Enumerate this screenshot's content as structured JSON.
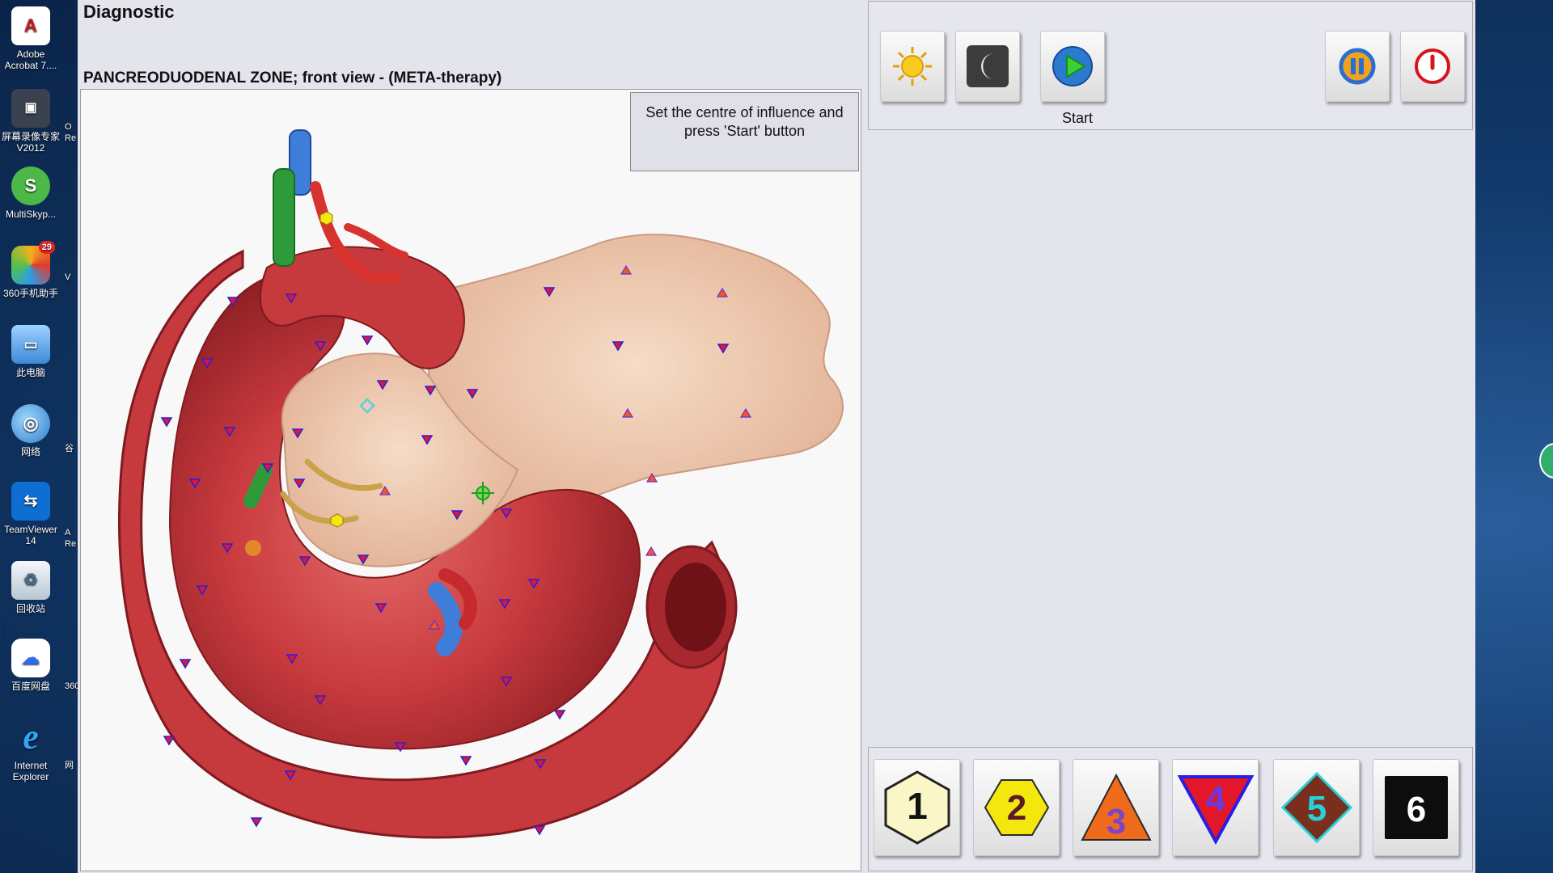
{
  "desktop": {
    "icons": [
      {
        "name": "adobe-acrobat",
        "label": "Adobe Acrobat 7...."
      },
      {
        "name": "screen-recorder",
        "label": "屏幕录像专家 V2012"
      },
      {
        "name": "multiskype",
        "label": "MultiSkyp..."
      },
      {
        "name": "360-phone-assistant",
        "label": "360手机助手",
        "badge": "29"
      },
      {
        "name": "this-pc",
        "label": "此电脑"
      },
      {
        "name": "network",
        "label": "网络"
      },
      {
        "name": "teamviewer",
        "label": "TeamViewer 14"
      },
      {
        "name": "recycle-bin",
        "label": "回收站"
      },
      {
        "name": "baidu-netdisk",
        "label": "百度网盘"
      },
      {
        "name": "internet-explorer",
        "label": "Internet Explorer"
      }
    ],
    "peek_labels": [
      "O Re",
      "V",
      "谷",
      "A Re",
      "360",
      "网"
    ]
  },
  "app": {
    "title": "Diagnostic",
    "zone_title": "PANCREODUODENAL ZONE; front view - (META-therapy)",
    "hint": "Set the centre of influence and press 'Start' button",
    "toolbar": {
      "day_icon": "sun-icon",
      "night_icon": "moon-icon",
      "start_icon": "play-icon",
      "start_label": "Start",
      "pause_icon": "pause-icon",
      "power_icon": "power-icon"
    },
    "levels": [
      {
        "label": "1",
        "shape": "hexagon",
        "fill": "#fbf6c7",
        "text_color": "#111111"
      },
      {
        "label": "2",
        "shape": "hexagon",
        "fill": "#f4e70d",
        "text_color": "#5a1a2a"
      },
      {
        "label": "3",
        "shape": "triangle-up",
        "fill": "#ef6a1a",
        "text_color": "#7a45c8"
      },
      {
        "label": "4",
        "shape": "triangle-down",
        "fill": "#e3162a",
        "text_color": "#6a3ae0"
      },
      {
        "label": "5",
        "shape": "diamond",
        "fill": "#7a2e1e",
        "text_color": "#28d0d8"
      },
      {
        "label": "6",
        "shape": "square",
        "fill": "#0d0d0d",
        "text_color": "#ffffff"
      }
    ],
    "colors": {
      "marker_down": "#e3162a",
      "marker_down_stroke": "#2a1ee0",
      "marker_up": "#ef5a1a",
      "marker_hex": "#f4e70d",
      "marker_diamond": "#5ad0d8",
      "target": "#18a028"
    }
  }
}
